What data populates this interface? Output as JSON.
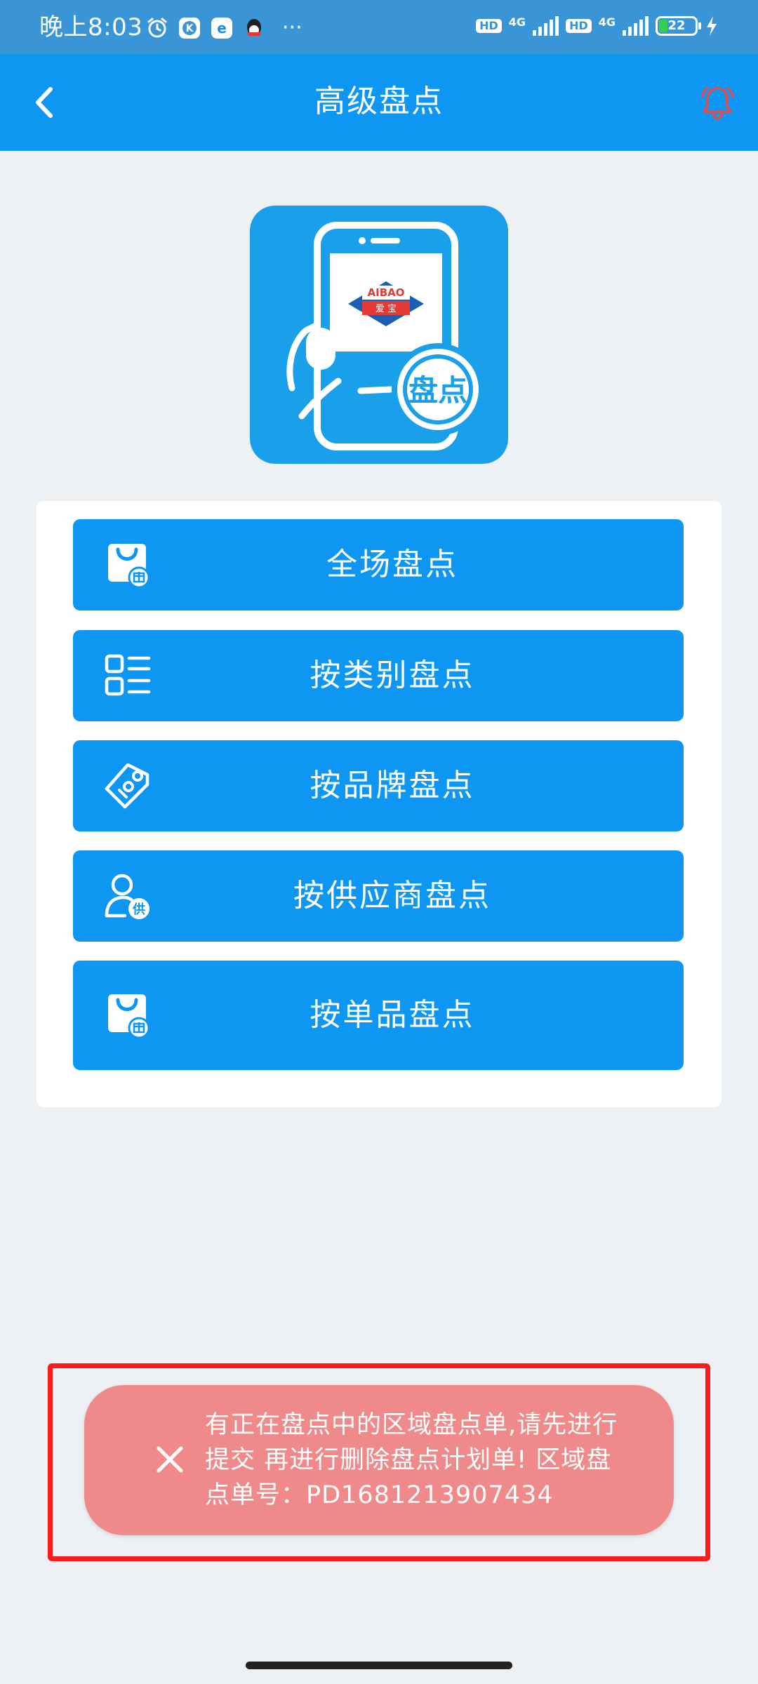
{
  "status_bar": {
    "time": "晚上8:03",
    "hd_label_1": "HD",
    "network_1": "4G",
    "hd_label_2": "HD",
    "network_2": "4G",
    "battery": "22",
    "more": "···"
  },
  "header": {
    "title": "高级盘点"
  },
  "logo": {
    "brand_text": "AIBAO",
    "brand_cn": "爱  宝",
    "badge_text": "盘点"
  },
  "menu": {
    "items": [
      {
        "label": "全场盘点",
        "icon": "shopping-bag-icon"
      },
      {
        "label": "按类别盘点",
        "icon": "category-list-icon"
      },
      {
        "label": "按品牌盘点",
        "icon": "brand-tag-icon"
      },
      {
        "label": "按供应商盘点",
        "icon": "supplier-person-icon"
      },
      {
        "label": "按单品盘点",
        "icon": "shopping-bag-icon"
      }
    ],
    "supplier_badge": "供"
  },
  "toast": {
    "message": "有正在盘点中的区域盘点单,请先进行提交 再进行删除盘点计划单! 区域盘点单号：PD1681213907434"
  },
  "colors": {
    "primary": "#0d97f2",
    "status_bar": "#3a95d6",
    "toast_bg": "#f08a8a",
    "highlight": "#ff1a1a",
    "bell": "#e84a4a",
    "background": "#eef1f4"
  }
}
